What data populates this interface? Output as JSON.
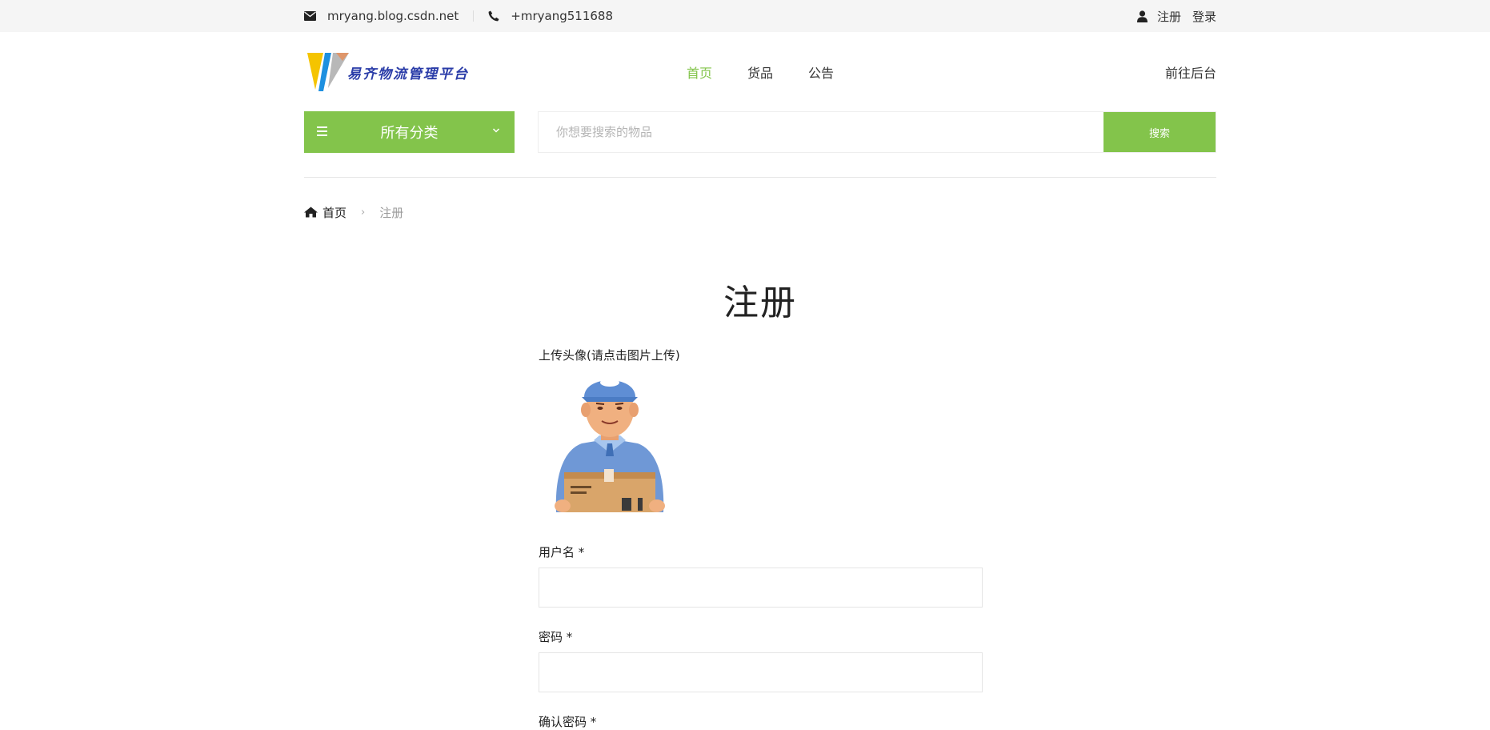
{
  "topbar": {
    "email": "mryang.blog.csdn.net",
    "phone": "+mryang511688",
    "register": "注册",
    "login": "登录"
  },
  "header": {
    "logo_text": "易齐物流管理平台",
    "nav": [
      "首页",
      "货品",
      "公告"
    ],
    "backend": "前往后台"
  },
  "category": {
    "label": "所有分类"
  },
  "search": {
    "placeholder": "你想要搜索的物品",
    "button": "搜索"
  },
  "breadcrumb": {
    "home": "首页",
    "current": "注册"
  },
  "form": {
    "title": "注册",
    "avatar_label": "上传头像(请点击图片上传)",
    "username_label": "用户名 *",
    "password_label": "密码 *",
    "confirm_label": "确认密码 *"
  },
  "colors": {
    "accent": "#83c44b",
    "topbar_bg": "#f5f5f5",
    "logo_text": "#2a3ca8"
  }
}
